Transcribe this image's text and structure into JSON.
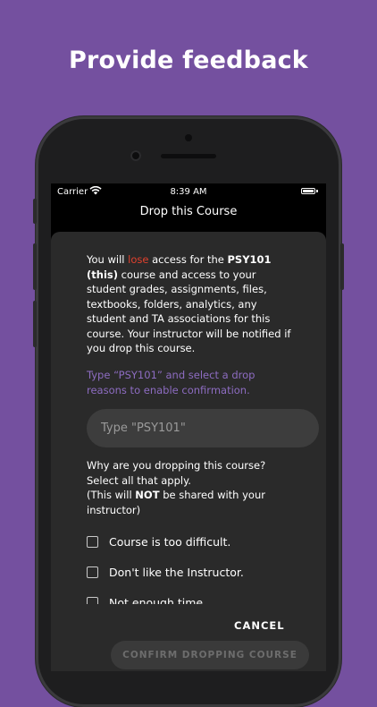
{
  "promo": {
    "headline": "Provide feedback"
  },
  "status_bar": {
    "carrier": "Carrier",
    "time": "8:39 AM"
  },
  "nav": {
    "title": "Drop this Course"
  },
  "warning": {
    "part1": "You will ",
    "lose_word": "lose",
    "part2": " access for the ",
    "course_bold": "PSY101 (this)",
    "part3": " course and access to your student grades, assignments, files, textbooks, folders, analytics, any student and TA associations for this course. Your instructor will be notified if you drop this course."
  },
  "hint": "Type “PSY101” and select a drop reasons to enable confirmation.",
  "confirm_input": {
    "placeholder": "Type \"PSY101\"",
    "value": ""
  },
  "reason_prompt": {
    "line1": "Why are you dropping this course? Select all that apply.",
    "line2_pre": "(This will ",
    "line2_bold": "NOT",
    "line2_post": " be shared with your instructor)"
  },
  "reasons": [
    {
      "label": "Course is too difficult.",
      "checked": false
    },
    {
      "label": "Don't like the Instructor.",
      "checked": false
    },
    {
      "label": "Not enough time",
      "checked": false
    }
  ],
  "actions": {
    "cancel_label": "CANCEL",
    "confirm_label": "CONFIRM DROPPING COURSE"
  },
  "colors": {
    "background": "#74509f",
    "accent_purple": "#8d6cc1",
    "warning_red": "#e0412e",
    "sheet": "#2a2a2a"
  }
}
